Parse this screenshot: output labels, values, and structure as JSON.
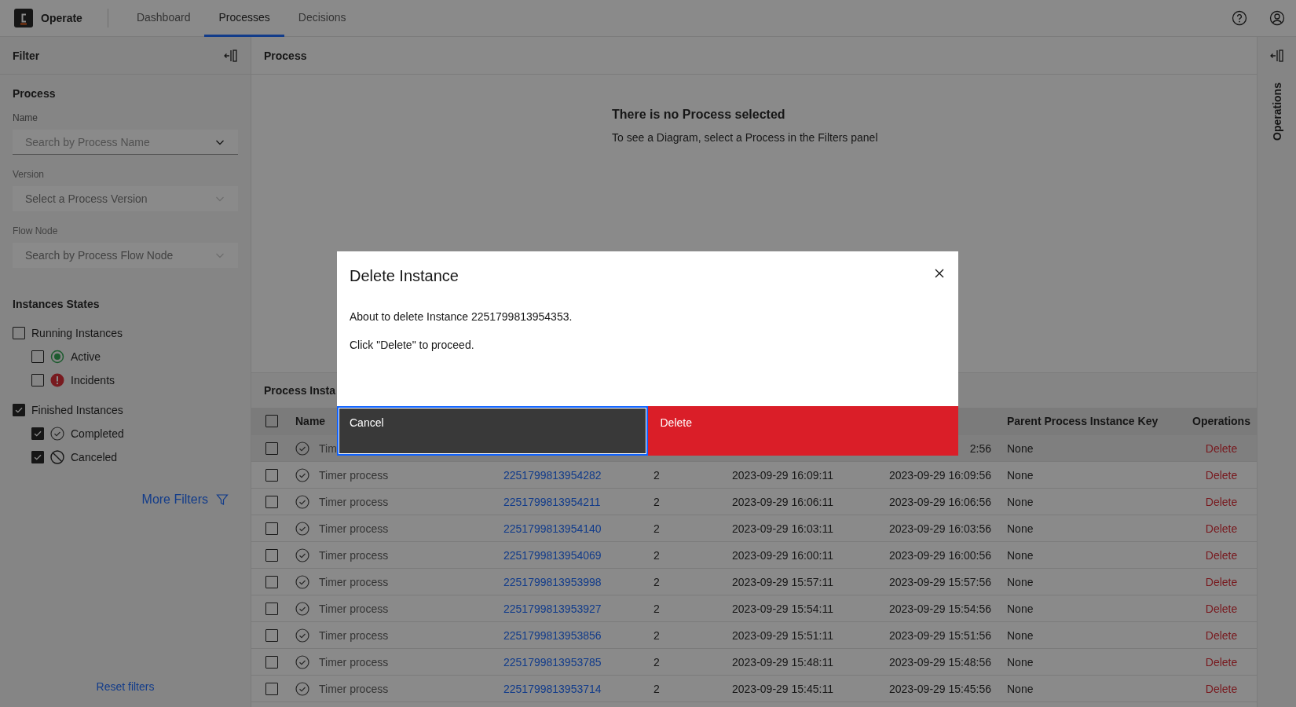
{
  "header": {
    "brand": "Operate",
    "tabs": [
      {
        "label": "Dashboard",
        "selected": false
      },
      {
        "label": "Processes",
        "selected": true
      },
      {
        "label": "Decisions",
        "selected": false
      }
    ]
  },
  "filter": {
    "title": "Filter",
    "section": "Process",
    "fields": [
      {
        "label": "Name",
        "placeholder": "Search by Process Name",
        "disabled": false
      },
      {
        "label": "Version",
        "placeholder": "Select a Process Version",
        "disabled": true
      },
      {
        "label": "Flow Node",
        "placeholder": "Search by Process Flow Node",
        "disabled": true
      }
    ],
    "states_title": "Instances States",
    "groups": [
      {
        "label": "Running Instances",
        "checked": false,
        "children": [
          {
            "label": "Active",
            "checked": false,
            "kind": "active"
          },
          {
            "label": "Incidents",
            "checked": false,
            "kind": "incident"
          }
        ]
      },
      {
        "label": "Finished Instances",
        "checked": true,
        "children": [
          {
            "label": "Completed",
            "checked": true,
            "kind": "completed"
          },
          {
            "label": "Canceled",
            "checked": true,
            "kind": "canceled"
          }
        ]
      }
    ],
    "more_filters": "More Filters",
    "reset": "Reset filters"
  },
  "diagram": {
    "title": "Process",
    "empty_title": "There is no Process selected",
    "empty_text": "To see a Diagram, select a Process in the Filters panel"
  },
  "operations_panel": {
    "title": "Operations"
  },
  "instances": {
    "title": "Process Insta",
    "all_checked": false,
    "columns": {
      "name": "Name",
      "parent": "Parent Process Instance Key",
      "operations": "Operations"
    },
    "rows": [
      {
        "checked": false,
        "highlighted": true,
        "name": "Tim",
        "end": "2:56",
        "parent": "None",
        "operation": "Delete"
      },
      {
        "checked": false,
        "highlighted": false,
        "name": "Timer process",
        "key": "2251799813954282",
        "version": "2",
        "start": "2023-09-29 16:09:11",
        "end": "2023-09-29 16:09:56",
        "parent": "None",
        "operation": "Delete"
      },
      {
        "checked": false,
        "highlighted": false,
        "name": "Timer process",
        "key": "2251799813954211",
        "version": "2",
        "start": "2023-09-29 16:06:11",
        "end": "2023-09-29 16:06:56",
        "parent": "None",
        "operation": "Delete"
      },
      {
        "checked": false,
        "highlighted": false,
        "name": "Timer process",
        "key": "2251799813954140",
        "version": "2",
        "start": "2023-09-29 16:03:11",
        "end": "2023-09-29 16:03:56",
        "parent": "None",
        "operation": "Delete"
      },
      {
        "checked": false,
        "highlighted": false,
        "name": "Timer process",
        "key": "2251799813954069",
        "version": "2",
        "start": "2023-09-29 16:00:11",
        "end": "2023-09-29 16:00:56",
        "parent": "None",
        "operation": "Delete"
      },
      {
        "checked": false,
        "highlighted": false,
        "name": "Timer process",
        "key": "2251799813953998",
        "version": "2",
        "start": "2023-09-29 15:57:11",
        "end": "2023-09-29 15:57:56",
        "parent": "None",
        "operation": "Delete"
      },
      {
        "checked": false,
        "highlighted": false,
        "name": "Timer process",
        "key": "2251799813953927",
        "version": "2",
        "start": "2023-09-29 15:54:11",
        "end": "2023-09-29 15:54:56",
        "parent": "None",
        "operation": "Delete"
      },
      {
        "checked": false,
        "highlighted": false,
        "name": "Timer process",
        "key": "2251799813953856",
        "version": "2",
        "start": "2023-09-29 15:51:11",
        "end": "2023-09-29 15:51:56",
        "parent": "None",
        "operation": "Delete"
      },
      {
        "checked": false,
        "highlighted": false,
        "name": "Timer process",
        "key": "2251799813953785",
        "version": "2",
        "start": "2023-09-29 15:48:11",
        "end": "2023-09-29 15:48:56",
        "parent": "None",
        "operation": "Delete"
      },
      {
        "checked": false,
        "highlighted": false,
        "name": "Timer process",
        "key": "2251799813953714",
        "version": "2",
        "start": "2023-09-29 15:45:11",
        "end": "2023-09-29 15:45:56",
        "parent": "None",
        "operation": "Delete"
      }
    ]
  },
  "modal": {
    "title": "Delete Instance",
    "lines": [
      "About to delete Instance 2251799813954353.",
      "Click \"Delete\" to proceed."
    ],
    "cancel": "Cancel",
    "confirm": "Delete"
  }
}
